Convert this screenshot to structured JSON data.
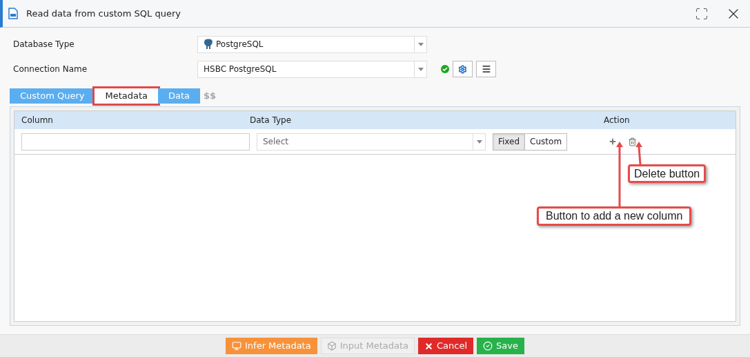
{
  "window": {
    "title": "Read data from custom SQL query"
  },
  "form": [
    {
      "label": "Database Type",
      "value": "PostgreSQL",
      "kind": "db"
    },
    {
      "label": "Connection Name",
      "value": "HSBC PostgreSQL",
      "kind": "connection",
      "connected": true
    }
  ],
  "tabs": [
    {
      "label": "Custom Query",
      "selected": false,
      "highlighted": false
    },
    {
      "label": "Metadata",
      "selected": true,
      "highlighted": true
    },
    {
      "label": "Data",
      "selected": false,
      "highlighted": false
    }
  ],
  "tabs_suffix": "$$",
  "table": {
    "columns": [
      "Column",
      "Data Type",
      "Action"
    ],
    "rows": [
      {
        "column": "",
        "data_type": {
          "placeholder": "Select"
        },
        "modes": [
          {
            "label": "Fixed",
            "selected": true
          },
          {
            "label": "Custom",
            "selected": false
          }
        ]
      }
    ]
  },
  "callouts": [
    {
      "text": "Delete button",
      "kind": "delete"
    },
    {
      "text": "Button to add a new column",
      "kind": "add"
    }
  ],
  "buttons": [
    {
      "label": "Infer Metadata",
      "kind": "infer",
      "disabled": false
    },
    {
      "label": "Input Metadata",
      "kind": "input",
      "disabled": true
    },
    {
      "label": "Cancel",
      "kind": "cancel",
      "disabled": false
    },
    {
      "label": "Save",
      "kind": "save",
      "disabled": false
    }
  ]
}
